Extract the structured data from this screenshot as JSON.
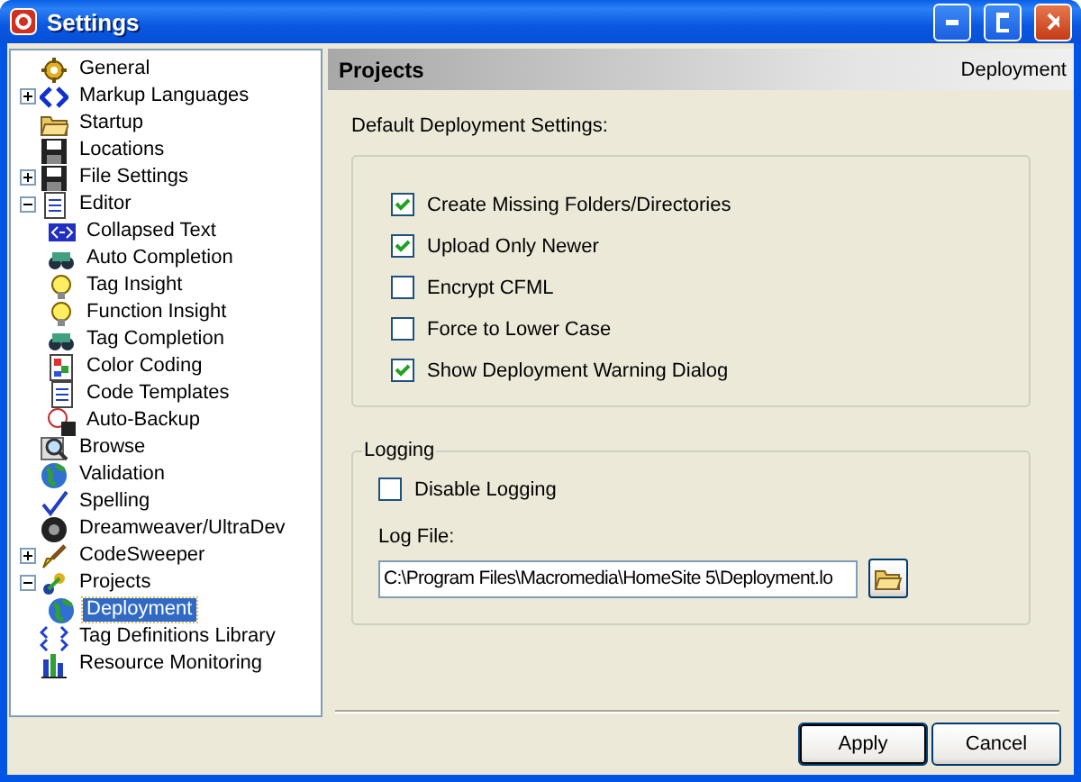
{
  "window": {
    "title": "Settings"
  },
  "tree": [
    {
      "label": "General",
      "selected": false
    },
    {
      "label": "Markup Languages",
      "selected": false,
      "expanded": false
    },
    {
      "label": "Startup",
      "selected": false
    },
    {
      "label": "Locations",
      "selected": false
    },
    {
      "label": "File Settings",
      "selected": false,
      "expanded": false
    },
    {
      "label": "Editor",
      "selected": false,
      "expanded": true,
      "children": [
        {
          "label": "Collapsed Text",
          "selected": false
        },
        {
          "label": "Auto Completion",
          "selected": false
        },
        {
          "label": "Tag Insight",
          "selected": false
        },
        {
          "label": "Function Insight",
          "selected": false
        },
        {
          "label": "Tag Completion",
          "selected": false
        },
        {
          "label": "Color Coding",
          "selected": false
        },
        {
          "label": "Code Templates",
          "selected": false
        },
        {
          "label": "Auto-Backup",
          "selected": false
        }
      ]
    },
    {
      "label": "Browse",
      "selected": false
    },
    {
      "label": "Validation",
      "selected": false
    },
    {
      "label": "Spelling",
      "selected": false
    },
    {
      "label": "Dreamweaver/UltraDev",
      "selected": false
    },
    {
      "label": "CodeSweeper",
      "selected": false,
      "expanded": false
    },
    {
      "label": "Projects",
      "selected": false,
      "expanded": true,
      "children": [
        {
          "label": "Deployment",
          "selected": true
        }
      ]
    },
    {
      "label": "Tag Definitions Library",
      "selected": false
    },
    {
      "label": "Resource Monitoring",
      "selected": false
    }
  ],
  "header": {
    "title": "Projects",
    "page": "Deployment"
  },
  "deployment": {
    "label": "Default Deployment Settings:",
    "options": [
      {
        "label": "Create Missing Folders/Directories",
        "checked": true
      },
      {
        "label": "Upload Only Newer",
        "checked": true
      },
      {
        "label": "Encrypt CFML",
        "checked": false
      },
      {
        "label": "Force to Lower Case",
        "checked": false
      },
      {
        "label": "Show Deployment Warning Dialog",
        "checked": true
      }
    ]
  },
  "logging": {
    "title": "Logging",
    "options": [
      {
        "label": "Disable Logging",
        "checked": false
      }
    ],
    "log_file_label": "Log File:",
    "log_file": "C:\\Program Files\\Macromedia\\HomeSite 5\\Deployment.lo"
  },
  "buttons": [
    {
      "label": "Apply",
      "default": true
    },
    {
      "label": "Cancel",
      "default": false
    }
  ]
}
